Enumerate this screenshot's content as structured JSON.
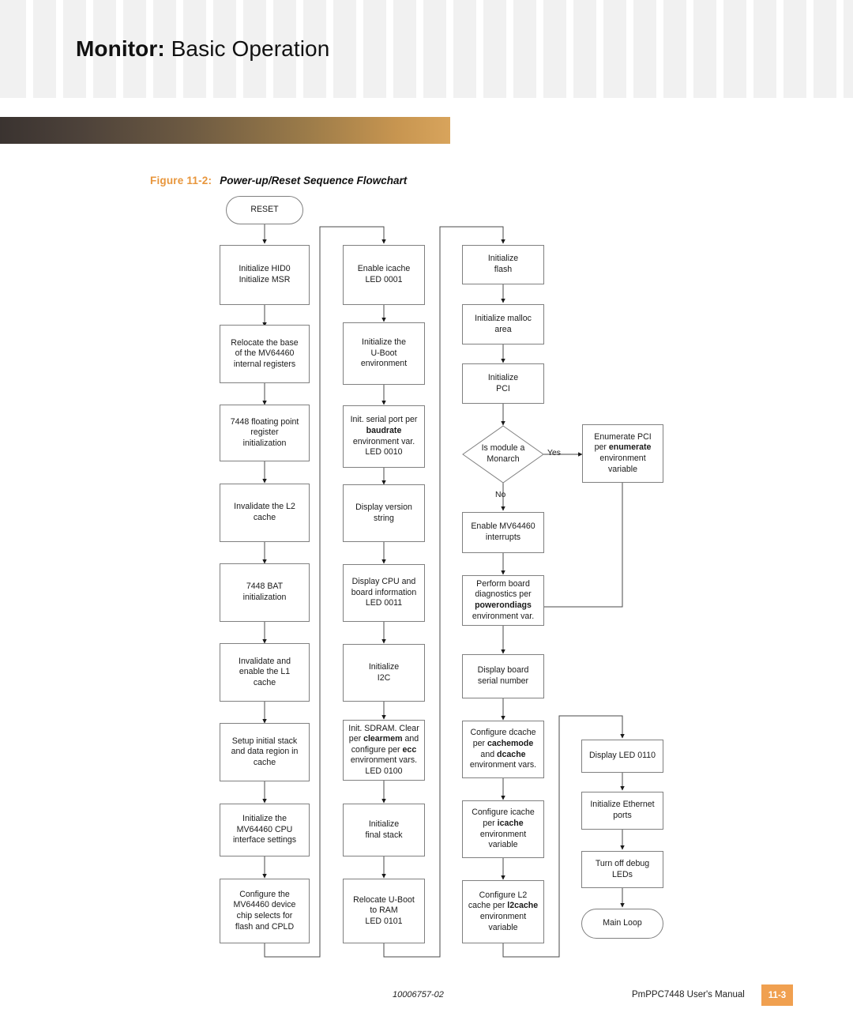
{
  "header": {
    "title_bold": "Monitor:",
    "title_light": "Basic Operation"
  },
  "figure": {
    "number": "Figure 11-2:",
    "caption": "Power-up/Reset Sequence Flowchart"
  },
  "flowchart": {
    "type": "flowchart",
    "title": "Power-up/Reset Sequence Flowchart",
    "columns": [
      {
        "name": "column-1",
        "nodes": [
          {
            "id": "reset",
            "shape": "terminator",
            "text": "RESET"
          },
          {
            "id": "init-hid0",
            "shape": "process",
            "lines": [
              "Initialize HID0",
              "Initialize MSR"
            ]
          },
          {
            "id": "relocate-base",
            "shape": "process",
            "lines": [
              "Relocate the base",
              "of the MV64460",
              "internal registers"
            ]
          },
          {
            "id": "fp-register-init",
            "shape": "process",
            "lines": [
              "7448 floating point",
              "register",
              "initialization"
            ]
          },
          {
            "id": "invalidate-l2",
            "shape": "process",
            "lines": [
              "Invalidate the L2",
              "cache"
            ]
          },
          {
            "id": "bat-init",
            "shape": "process",
            "lines": [
              "7448 BAT",
              "initialization"
            ]
          },
          {
            "id": "invalidate-enable-l1",
            "shape": "process",
            "lines": [
              "Invalidate and",
              "enable the L1",
              "cache"
            ]
          },
          {
            "id": "setup-initial-stack",
            "shape": "process",
            "lines": [
              "Setup initial stack",
              "and data region in",
              "cache"
            ]
          },
          {
            "id": "init-cpu-interface",
            "shape": "process",
            "lines": [
              "Initialize the",
              "MV64460 CPU",
              "interface settings"
            ]
          },
          {
            "id": "configure-chip-selects",
            "shape": "process",
            "lines": [
              "Configure the",
              "MV64460 device",
              "chip selects for",
              "flash and CPLD"
            ]
          }
        ]
      },
      {
        "name": "column-2",
        "nodes": [
          {
            "id": "enable-icache",
            "shape": "process",
            "lines": [
              "Enable icache",
              "LED 0001"
            ]
          },
          {
            "id": "init-uboot-env",
            "shape": "process",
            "lines": [
              "Initialize the",
              "U-Boot",
              "environment"
            ]
          },
          {
            "id": "init-serial-port",
            "shape": "process",
            "lines": [
              "Init. serial port per",
              "baudrate",
              "environment var.",
              "LED 0010"
            ],
            "bold": [
              "baudrate"
            ]
          },
          {
            "id": "display-version",
            "shape": "process",
            "lines": [
              "Display version",
              "string"
            ]
          },
          {
            "id": "display-cpu-board",
            "shape": "process",
            "lines": [
              "Display CPU and",
              "board information",
              "LED 0011"
            ]
          },
          {
            "id": "init-i2c",
            "shape": "process",
            "lines": [
              "Initialize",
              "I2C"
            ]
          },
          {
            "id": "init-sdram",
            "shape": "process",
            "lines": [
              "Init. SDRAM. Clear",
              "per clearmem and",
              "configure per ecc",
              "environment vars.",
              "LED 0100"
            ],
            "bold": [
              "clearmem",
              "ecc"
            ]
          },
          {
            "id": "init-final-stack",
            "shape": "process",
            "lines": [
              "Initialize",
              "final stack"
            ]
          },
          {
            "id": "relocate-uboot",
            "shape": "process",
            "lines": [
              "Relocate U-Boot",
              "to RAM",
              "LED 0101"
            ]
          }
        ]
      },
      {
        "name": "column-3",
        "nodes": [
          {
            "id": "init-flash",
            "shape": "process",
            "lines": [
              "Initialize",
              "flash"
            ]
          },
          {
            "id": "init-malloc",
            "shape": "process",
            "lines": [
              "Initialize malloc",
              "area"
            ]
          },
          {
            "id": "init-pci",
            "shape": "process",
            "lines": [
              "Initialize",
              "PCI"
            ]
          },
          {
            "id": "is-monarch",
            "shape": "decision",
            "lines": [
              "Is module a",
              "Monarch"
            ]
          },
          {
            "id": "enumerate-pci",
            "shape": "process",
            "lines": [
              "Enumerate PCI",
              "per enumerate",
              "environment",
              "variable"
            ],
            "bold": [
              "enumerate"
            ]
          },
          {
            "id": "enable-interrupts",
            "shape": "process",
            "lines": [
              "Enable MV64460",
              "interrupts"
            ]
          },
          {
            "id": "board-diagnostics",
            "shape": "process",
            "lines": [
              "Perform board",
              "diagnostics per",
              "powerondiags",
              "environment var."
            ],
            "bold": [
              "powerondiags"
            ]
          },
          {
            "id": "display-serial-number",
            "shape": "process",
            "lines": [
              "Display board",
              "serial number"
            ]
          },
          {
            "id": "configure-dcache",
            "shape": "process",
            "lines": [
              "Configure dcache",
              "per cachemode",
              "and dcache",
              "environment vars."
            ],
            "bold": [
              "cachemode",
              "dcache"
            ]
          },
          {
            "id": "configure-icache",
            "shape": "process",
            "lines": [
              "Configure icache",
              "per icache",
              "environment",
              "variable"
            ],
            "bold": [
              "icache"
            ]
          },
          {
            "id": "configure-l2",
            "shape": "process",
            "lines": [
              "Configure L2",
              "cache per l2cache",
              "environment",
              "variable"
            ],
            "bold": [
              "l2cache"
            ]
          }
        ]
      },
      {
        "name": "column-4",
        "nodes": [
          {
            "id": "display-led-0110",
            "shape": "process",
            "lines": [
              "Display LED 0110"
            ]
          },
          {
            "id": "init-ethernet",
            "shape": "process",
            "lines": [
              "Initialize Ethernet",
              "ports"
            ]
          },
          {
            "id": "turn-off-debug-leds",
            "shape": "process",
            "lines": [
              "Turn off debug",
              "LEDs"
            ]
          },
          {
            "id": "main-loop",
            "shape": "terminator",
            "text": "Main Loop"
          }
        ]
      }
    ],
    "edge_labels": {
      "yes": "Yes",
      "no": "No"
    }
  },
  "nodes": {
    "reset": "RESET",
    "init_hid0": "Initialize HID0\nInitialize MSR",
    "relocate_base": "Relocate the base\nof the MV64460\ninternal registers",
    "fp_register_init": "7448 floating point\nregister\ninitialization",
    "invalidate_l2": "Invalidate the L2\ncache",
    "bat_init": "7448 BAT\ninitialization",
    "invalidate_enable_l1": "Invalidate and\nenable the L1\ncache",
    "setup_initial_stack": "Setup initial stack\nand data region in\ncache",
    "init_cpu_interface": "Initialize the\nMV64460 CPU\ninterface settings",
    "configure_chip_selects": "Configure the\nMV64460 device\nchip selects for\nflash and CPLD",
    "enable_icache": "Enable icache\nLED 0001",
    "init_uboot_env": "Initialize the\nU-Boot\nenvironment",
    "display_version": "Display version\nstring",
    "display_cpu_board": "Display CPU and\nboard information\nLED 0011",
    "init_i2c": "Initialize\nI2C",
    "init_final_stack": "Initialize\nfinal stack",
    "relocate_uboot": "Relocate U-Boot\nto RAM\nLED 0101",
    "init_flash": "Initialize\nflash",
    "init_malloc": "Initialize malloc\narea",
    "init_pci": "Initialize\nPCI",
    "is_monarch": "Is module a\nMonarch",
    "enable_interrupts": "Enable MV64460\ninterrupts",
    "display_serial_number": "Display board\nserial number",
    "display_led_0110": "Display LED 0110",
    "init_ethernet": "Initialize Ethernet\nports",
    "turn_off_debug_leds": "Turn off debug\nLEDs",
    "main_loop": "Main Loop"
  },
  "rich_nodes": {
    "init_serial_port": {
      "l1": "Init. serial port per",
      "l2": "baudrate",
      "l3": "environment var.",
      "l4": "LED 0010"
    },
    "init_sdram": {
      "l1a": "Init. SDRAM. Clear",
      "l2a": "per ",
      "l2b": "clearmem",
      "l2c": " and",
      "l3a": "configure per ",
      "l3b": "ecc",
      "l4": "environment vars.",
      "l5": "LED 0100"
    },
    "enumerate_pci": {
      "l1": "Enumerate PCI",
      "l2a": "per ",
      "l2b": "enumerate",
      "l3": "environment",
      "l4": "variable"
    },
    "board_diagnostics": {
      "l1": "Perform board",
      "l2": "diagnostics per",
      "l3": "powerondiags",
      "l4": "environment var."
    },
    "configure_dcache": {
      "l1": "Configure dcache",
      "l2a": "per ",
      "l2b": "cachemode",
      "l3a": "and ",
      "l3b": "dcache",
      "l4": "environment vars."
    },
    "configure_icache": {
      "l1": "Configure icache",
      "l2a": "per ",
      "l2b": "icache",
      "l3": "environment",
      "l4": "variable"
    },
    "configure_l2": {
      "l1": "Configure L2",
      "l2a": "cache per ",
      "l2b": "l2cache",
      "l3": "environment",
      "l4": "variable"
    }
  },
  "labels": {
    "yes": "Yes",
    "no": "No"
  },
  "footer": {
    "doc_id": "10006757-02",
    "manual": "PmPPC7448 User's Manual",
    "page_number": "11-3"
  },
  "colors": {
    "accent_orange": "#e8963c",
    "page_tab": "#f0a050",
    "box_border": "#808080",
    "grid_square": "#f1f1f1"
  }
}
